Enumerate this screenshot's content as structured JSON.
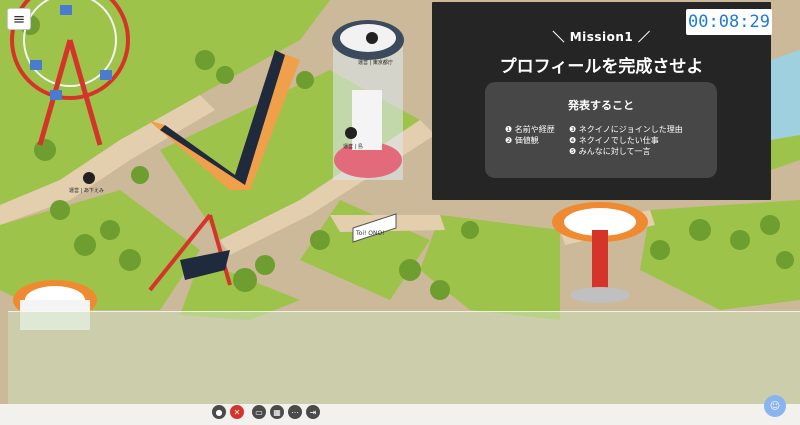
{
  "mission": {
    "label": "＼ Mission1 ／",
    "title": "プロフィールを完成させよ",
    "box_title": "発表すること",
    "items_left": [
      "❶ 名前や経歴",
      "❷ 価値観"
    ],
    "items_right": [
      "❸ ネクイノにジョインした理由",
      "❹ ネクイノでしたい仕事",
      "❺ みんなに対して一言"
    ]
  },
  "timer": {
    "value": "00:08:29",
    "color": "#1e7ad6"
  },
  "signs": {
    "toilet": "Toi! ONO!"
  },
  "avatars": [
    {
      "label": "運営 | 東京都庁"
    },
    {
      "label": "運営 | 島"
    },
    {
      "label": "運営 | あ下えみ"
    }
  ],
  "icons": {
    "menu": "hamburger-menu-icon",
    "chat": "chat-bubble-icon",
    "controls": [
      "speech-bubble-icon",
      "mic-off-icon",
      "screen-share-icon",
      "map-icon",
      "more-icon",
      "exit-icon"
    ]
  },
  "colors": {
    "overlay": "#252525",
    "grass": "#9ec34a",
    "path": "#d9c4a0",
    "ferris": "#d4342a"
  }
}
